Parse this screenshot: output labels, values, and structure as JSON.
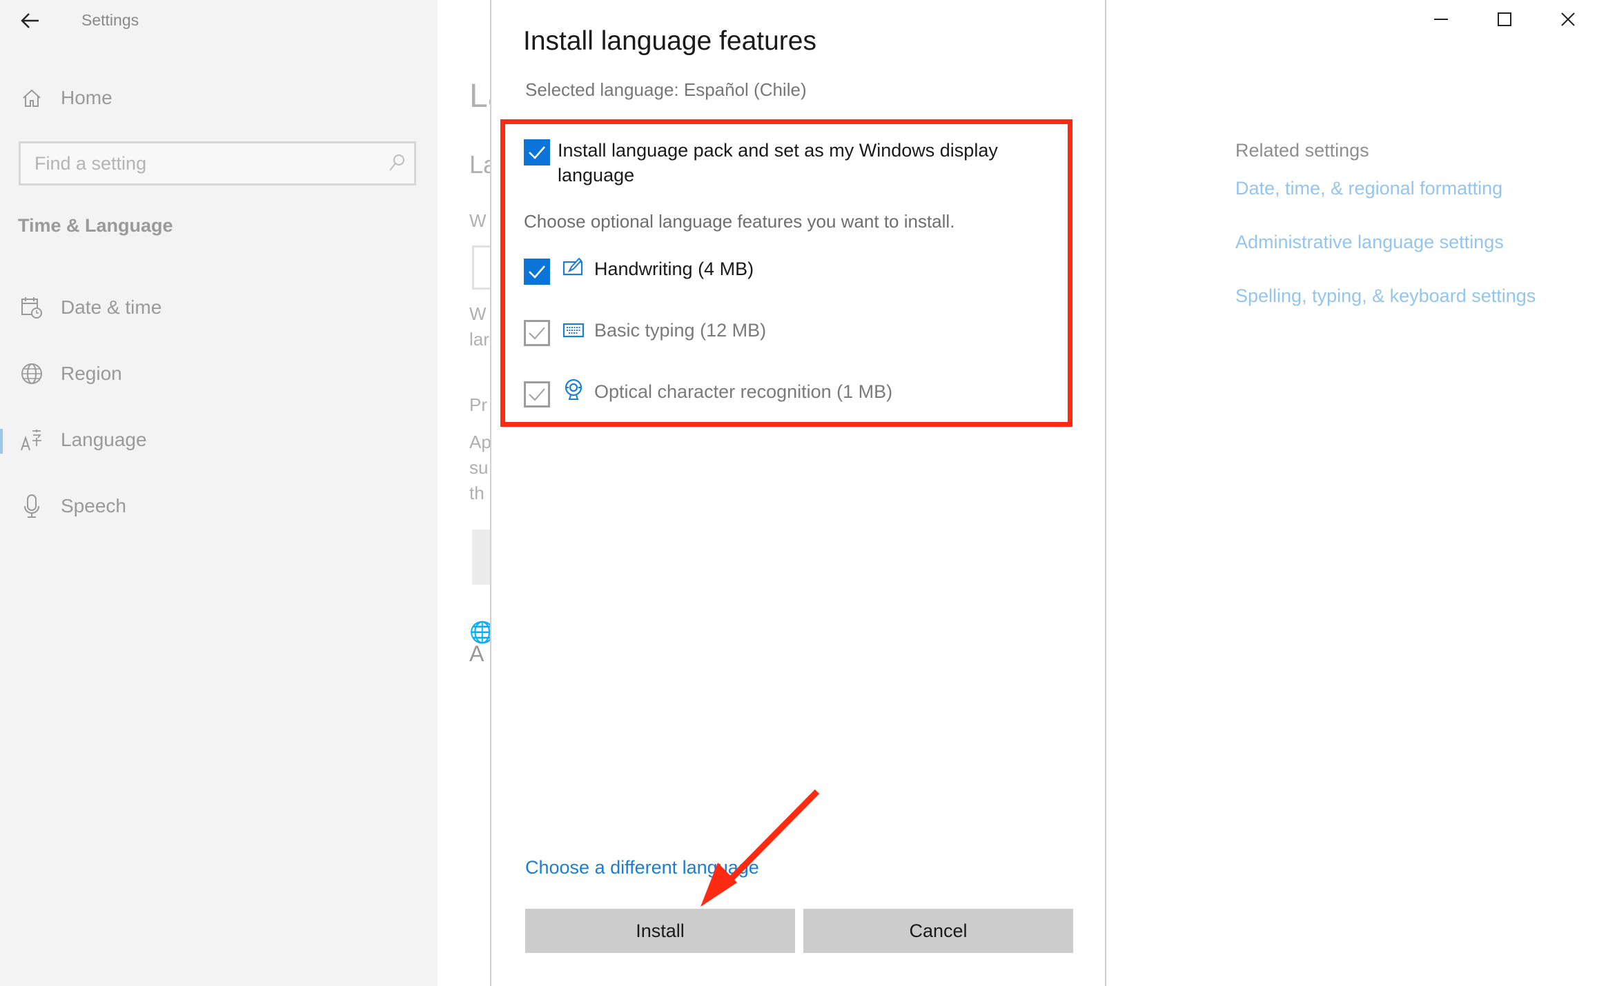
{
  "window": {
    "title": "Settings",
    "controls": {
      "minimize": "minimize",
      "maximize": "maximize",
      "close": "close"
    }
  },
  "sidebar": {
    "home_label": "Home",
    "search_placeholder": "Find a setting",
    "section_title": "Time & Language",
    "items": [
      {
        "label": "Date & time",
        "icon": "calendar-clock-icon",
        "active": false
      },
      {
        "label": "Region",
        "icon": "globe-icon",
        "active": false
      },
      {
        "label": "Language",
        "icon": "language-icon",
        "active": true
      },
      {
        "label": "Speech",
        "icon": "microphone-icon",
        "active": false
      }
    ]
  },
  "background_main": {
    "fragments": [
      "La",
      "La",
      "W",
      "W",
      "lar",
      "Pr",
      "Ap",
      "su",
      "th",
      "A"
    ]
  },
  "dialog": {
    "title": "Install language features",
    "selected_language": "Selected language: Español (Chile)",
    "install_pack_label": "Install language pack and set as my Windows display language",
    "install_pack_checked": true,
    "optional_hint": "Choose optional language features you want to install.",
    "features": [
      {
        "label": "Handwriting (4 MB)",
        "icon": "handwriting-icon",
        "checked": true,
        "disabled": false
      },
      {
        "label": "Basic typing (12 MB)",
        "icon": "keyboard-icon",
        "checked": true,
        "disabled": true
      },
      {
        "label": "Optical character recognition (1 MB)",
        "icon": "webcam-icon",
        "checked": true,
        "disabled": true
      }
    ],
    "choose_link": "Choose a different language",
    "install_button": "Install",
    "cancel_button": "Cancel"
  },
  "related": {
    "heading": "Related settings",
    "links": [
      "Date, time, & regional formatting",
      "Administrative language settings",
      "Spelling, typing, & keyboard settings"
    ]
  },
  "annotation": {
    "highlight_color": "#ff2a12",
    "arrow_color": "#ff2a12",
    "arrow_target": "Install"
  },
  "colors": {
    "accent": "#0a74d8",
    "link": "#1a7ed6",
    "related_link": "#94c5ef"
  }
}
